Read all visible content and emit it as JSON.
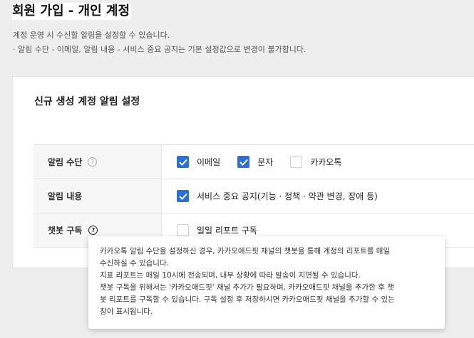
{
  "page": {
    "title": "회원 가입 - 개인 계정",
    "desc1": "계정 운영 시 수신할 알림을 설정할 수 있습니다.",
    "desc2": "· 알림 수단 - 이메일, 알림 내용 - 서비스 중요 공지는 기본 설정값으로 변경이 불가합니다."
  },
  "card": {
    "title": "신규 생성 계정 알림 설정"
  },
  "rows": [
    {
      "label": "알림 수단",
      "options": [
        {
          "label": "이메일",
          "checked": true
        },
        {
          "label": "문자",
          "checked": true
        },
        {
          "label": "카카오톡",
          "checked": false
        }
      ]
    },
    {
      "label": "알림 내용",
      "options": [
        {
          "label": "서비스 중요 공지(기능 · 정책 · 약관 변경, 장애 등)",
          "checked": true
        }
      ]
    },
    {
      "label": "챗봇 구독",
      "options": [
        {
          "label": "일일 리포트 구독",
          "checked": false
        }
      ]
    }
  ],
  "tooltip": {
    "lines": [
      "카카오톡 알림 수단을 설정하신 경우, 카카오애드핏 채널의 챗봇을 통해 계정의 리포트를 매일",
      "수신하실 수 있습니다.",
      "지표 리포트는 매일 10시에 전송되며, 내부 상황에 따라 발송이 지연될 수 있습니다.",
      "챗봇 구독을 위해서는 '카카오애드핏' 채널 추가가 필요하며, 카카오애드핏 채널을 추가한 후 챗",
      "봇 리포트를 구독할 수 있습니다. 구독 설정 후 저장하시면 카카오애드핏 채널을 추가할 수 있는",
      "창이 표시됩니다."
    ]
  },
  "colors": {
    "accent": "#2c6fd8",
    "background": "#eeeeee"
  }
}
